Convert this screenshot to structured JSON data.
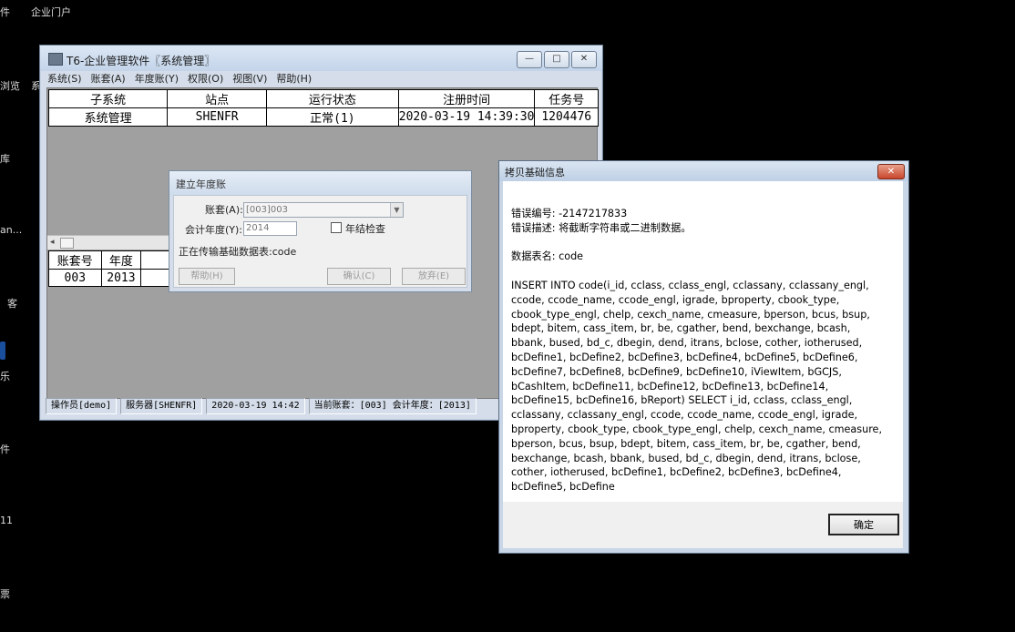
{
  "desktop": {
    "labels": [
      "件",
      "企业门户",
      "浏览",
      "系",
      "库",
      "an...",
      "客",
      "乐",
      "件",
      "11",
      "票"
    ]
  },
  "main_window": {
    "title": "T6-企业管理软件〖系统管理〗",
    "caption_buttons": {
      "minimize": "—",
      "maximize": "□",
      "close": "✕"
    },
    "menu": [
      "系统(S)",
      "账套(A)",
      "年度账(Y)",
      "权限(O)",
      "视图(V)",
      "帮助(H)"
    ],
    "upper_table": {
      "headers": [
        "子系统",
        "站点",
        "运行状态",
        "注册时间",
        "任务号"
      ],
      "rows": [
        [
          "系统管理",
          "SHENFR",
          "正常(1)",
          "2020-03-19 14:39:30",
          "1204476"
        ]
      ]
    },
    "lower_table": {
      "headers": [
        "账套号",
        "年度"
      ],
      "rows": [
        [
          "003",
          "2013"
        ]
      ]
    },
    "status": [
      "操作员[demo]",
      "服务器[SHENFR]",
      "2020-03-19 14:42",
      "当前账套：[003] 会计年度：[2013]"
    ]
  },
  "year_dialog": {
    "title": "建立年度账",
    "account_label": "账套(A):",
    "account_value": "[003]003",
    "year_label": "会计年度(Y):",
    "year_value": "2014",
    "year_end_check_label": "年结检查",
    "progress_text": "正在传输基础数据表:code",
    "help_button": "帮助(H)",
    "ok_button": "确认(C)",
    "cancel_button": "放弃(E)"
  },
  "error_dialog": {
    "title": "拷贝基础信息",
    "close_glyph": "✕",
    "error_code_line": "错误编号: -2147217833",
    "error_desc_line": "错误描述: 将截断字符串或二进制数据。",
    "table_name_line": "数据表名: code",
    "sql": "INSERT INTO code(i_id, cclass, cclass_engl, cclassany, cclassany_engl, ccode, ccode_name, ccode_engl, igrade, bproperty, cbook_type, cbook_type_engl, chelp, cexch_name, cmeasure, bperson, bcus, bsup, bdept, bitem, cass_item, br, be, cgather, bend, bexchange, bcash, bbank, bused, bd_c, dbegin, dend, itrans, bclose, cother, iotherused, bcDefine1, bcDefine2, bcDefine3, bcDefine4, bcDefine5, bcDefine6, bcDefine7, bcDefine8, bcDefine9, bcDefine10, iViewItem, bGCJS, bCashItem, bcDefine11, bcDefine12, bcDefine13, bcDefine14, bcDefine15, bcDefine16, bReport) SELECT  i_id, cclass, cclass_engl, cclassany, cclassany_engl, ccode, ccode_name, ccode_engl, igrade, bproperty, cbook_type, cbook_type_engl, chelp, cexch_name, cmeasure, bperson, bcus, bsup, bdept, bitem, cass_item, br, be, cgather, bend, bexchange, bcash, bbank, bused, bd_c, dbegin, dend, itrans, bclose, cother, iotherused, bcDefine1, bcDefine2, bcDefine3, bcDefine4, bcDefine5, bcDefine",
    "ok_button": "确定"
  }
}
